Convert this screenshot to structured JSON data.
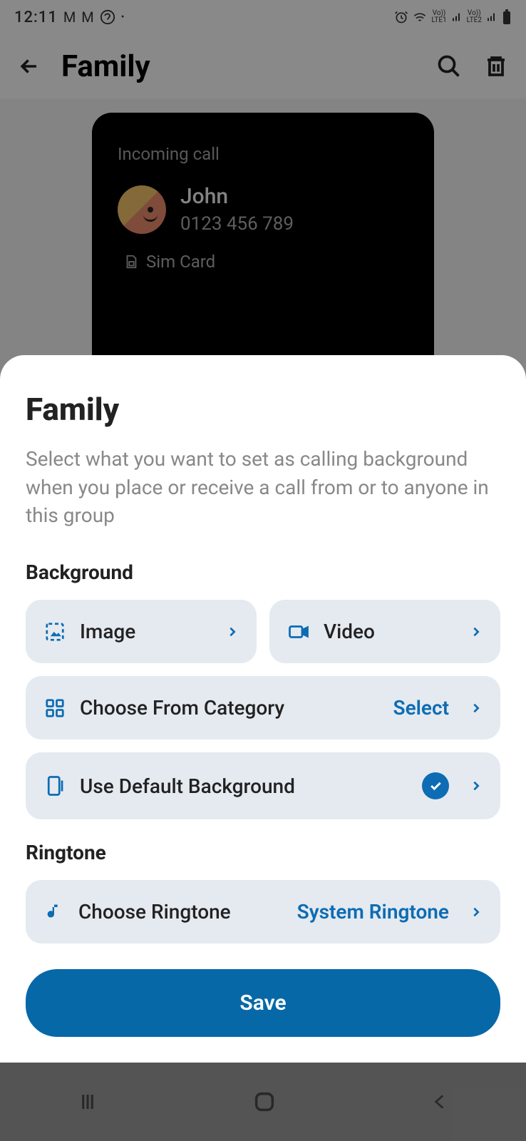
{
  "status": {
    "time": "12:11",
    "lte1": "LTE1",
    "lte2": "LTE2",
    "vo": "Vo))"
  },
  "header": {
    "title": "Family"
  },
  "preview": {
    "incoming_label": "Incoming call",
    "contact_name": "John",
    "contact_number": "0123 456 789",
    "sim_label": "Sim Card"
  },
  "sheet": {
    "title": "Family",
    "description": "Select what you want to set as calling background when you place or receive a call from or to anyone in this group",
    "background_section": "Background",
    "image_label": "Image",
    "video_label": "Video",
    "category_label": "Choose From Category",
    "category_value": "Select",
    "default_bg_label": "Use Default Background",
    "ringtone_section": "Ringtone",
    "ringtone_label": "Choose Ringtone",
    "ringtone_value": "System Ringtone",
    "save_label": "Save"
  }
}
